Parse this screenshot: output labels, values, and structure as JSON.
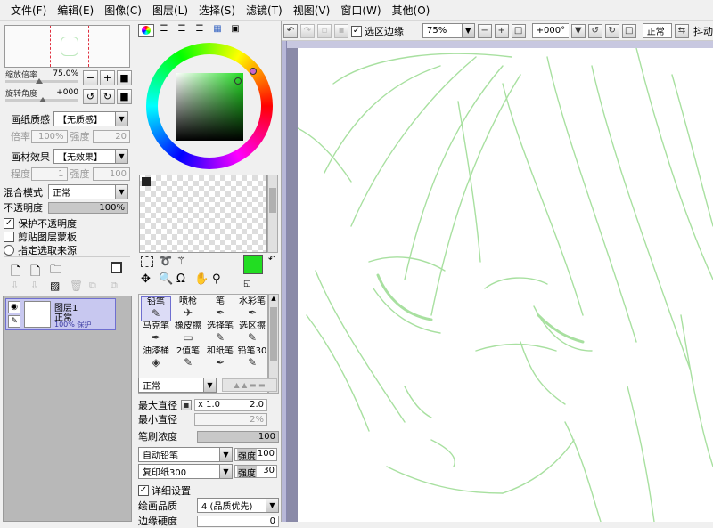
{
  "menu": [
    "文件(F)",
    "编辑(E)",
    "图像(C)",
    "图层(L)",
    "选择(S)",
    "滤镜(T)",
    "视图(V)",
    "窗口(W)",
    "其他(O)"
  ],
  "toolbar": {
    "select_edge_label": "选区边缘",
    "zoom": "75%",
    "rotation": "+000°",
    "mode": "正常",
    "trailing": "抖动"
  },
  "navigator": {
    "zoom_label": "缩放倍率",
    "zoom_value": "75.0%",
    "rotate_label": "旋转角度",
    "rotate_value": "+000"
  },
  "paper": {
    "texture_label": "画纸质感",
    "texture_value": "【无质感】",
    "scale_label": "倍率",
    "scale_value": "100%",
    "strength_label": "强度",
    "strength_value": "20"
  },
  "material": {
    "label": "画材效果",
    "value": "【无效果】",
    "degree_label": "程度",
    "degree_value": "1",
    "strength_label": "强度",
    "strength_value": "100"
  },
  "layer": {
    "blend_label": "混合模式",
    "blend_value": "正常",
    "opacity_label": "不透明度",
    "opacity_value": "100%",
    "protect_opacity": "保护不透明度",
    "clip_group": "剪贴图层蒙板",
    "select_source": "指定选取来源"
  },
  "layers": [
    {
      "name": "图层1",
      "mode": "正常",
      "info": "100% 保护"
    }
  ],
  "colors": {
    "primary": "#22dd22",
    "wheel_ring_marker": "#cc66cc"
  },
  "tools": [
    {
      "label": "铅笔",
      "icon": "✎"
    },
    {
      "label": "喷枪",
      "icon": "✈"
    },
    {
      "label": "笔",
      "icon": "✒"
    },
    {
      "label": "水彩笔",
      "icon": "✒"
    },
    {
      "label": "马克笔",
      "icon": "✒"
    },
    {
      "label": "橡皮擦",
      "icon": "▭"
    },
    {
      "label": "选择笔",
      "icon": "✎"
    },
    {
      "label": "选区擦",
      "icon": "✎"
    },
    {
      "label": "油漆桶",
      "icon": "◈"
    },
    {
      "label": "2值笔",
      "icon": "✎"
    },
    {
      "label": "和纸笔",
      "icon": "✒"
    },
    {
      "label": "铅笔30",
      "icon": "✎"
    }
  ],
  "brush": {
    "mode": "正常",
    "max_size_label": "最大直径",
    "max_size_mult": "x 1.0",
    "max_size_value": "2.0",
    "min_size_label": "最小直径",
    "min_size_value": "2%",
    "density_label": "笔刷浓度",
    "density_value": "100",
    "shape": "自动铅笔",
    "shape_strength_label": "强度",
    "shape_strength_value": "100",
    "texture": "复印纸300",
    "texture_strength_label": "强度",
    "texture_strength_value": "30",
    "detail_label": "详细设置",
    "quality_label": "绘画品质",
    "quality_value": "4 (品质优先)",
    "edge_label": "边缘硬度",
    "edge_value": "0"
  }
}
